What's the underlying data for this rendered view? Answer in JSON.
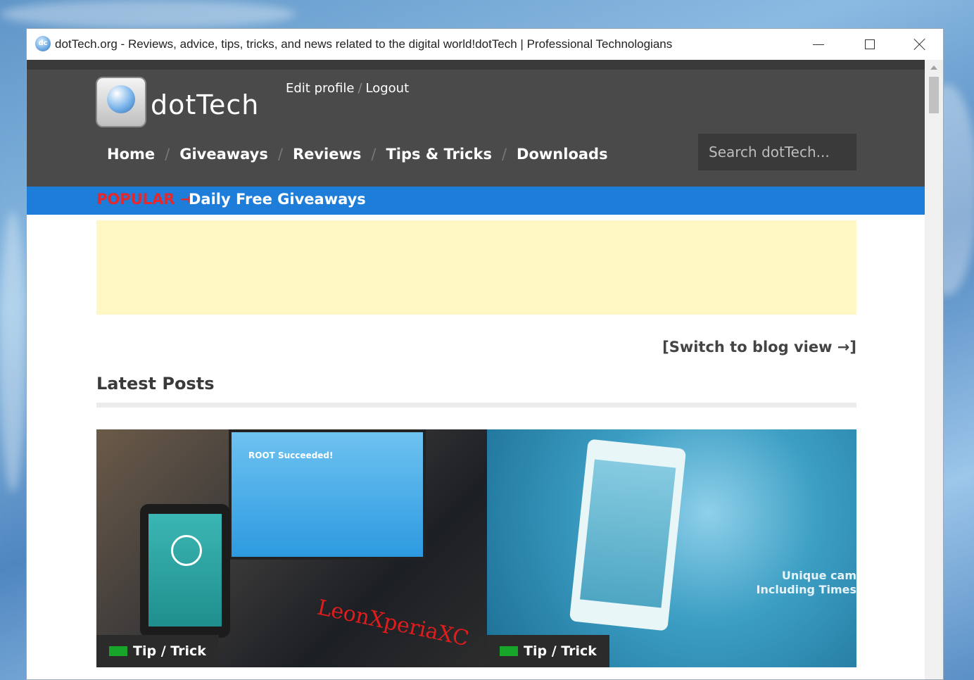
{
  "window": {
    "title": "dotTech.org - Reviews, advice, tips, tricks, and news related to the digital world!dotTech | Professional Technologians",
    "icon": "dottech-favicon-icon",
    "controls": {
      "minimize": "minimize-icon",
      "maximize": "maximize-icon",
      "close": "close-icon"
    }
  },
  "site": {
    "logo_text": "dotTech",
    "user_links": {
      "edit_profile": "Edit profile",
      "separator": "/",
      "logout": "Logout"
    },
    "nav": {
      "home": "Home",
      "giveaways": "Giveaways",
      "reviews": "Reviews",
      "tips": "Tips & Tricks",
      "downloads": "Downloads",
      "separator": "/"
    },
    "search_placeholder": "Search dotTech..."
  },
  "popular": {
    "label": "POPULAR →",
    "link": "Daily Free Giveaways"
  },
  "content": {
    "switch_view": "[Switch to blog view →]",
    "latest_heading": "Latest Posts"
  },
  "posts": [
    {
      "category": "Tip / Trick",
      "image_text": "ROOT Succeeded!",
      "watermark": "LeonXperiaXC"
    },
    {
      "category": "Tip / Trick",
      "overlay_line1": "Unique cam",
      "overlay_line2": "Including Times"
    }
  ],
  "colors": {
    "header_bg": "#4a4a4a",
    "popular_bar": "#1e7dd8",
    "popular_label": "#e8272b",
    "ad_bg": "#fff8c4",
    "badge_square": "#17a52a"
  }
}
